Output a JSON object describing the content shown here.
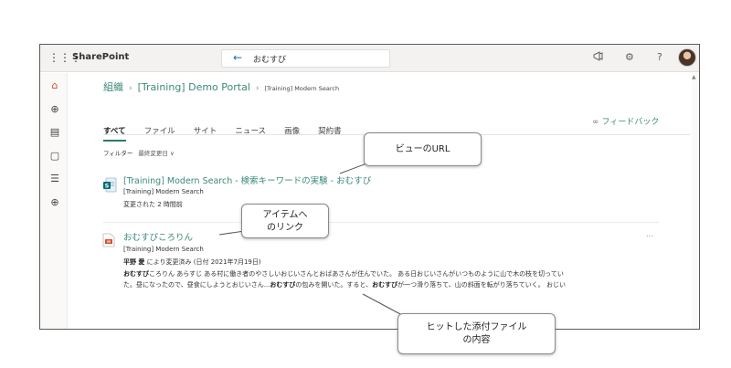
{
  "suitebar": {
    "app_name": "SharePoint",
    "back_arrow": "←",
    "search_query": "おむすび",
    "icons": [
      "megaphone-icon",
      "gear-icon",
      "help-icon"
    ],
    "help_glyph": "?"
  },
  "breadcrumb": {
    "item1": "組織",
    "item2": "[Training] Demo Portal",
    "item3": "[Training] Modern Search",
    "sep": "›"
  },
  "tabs": [
    "すべて",
    "ファイル",
    "サイト",
    "ニュース",
    "画像",
    "契約書"
  ],
  "feedback": {
    "label": "フィードバック"
  },
  "filter": {
    "label": "フィルター",
    "date_filter": "最終変更日 ∨"
  },
  "results": [
    {
      "title": "[Training] Modern Search - 検索キーワードの実験 - おむすび",
      "site": "[Training] Modern Search",
      "meta": "変更された 2 時間前",
      "icon": "sharepoint-page-icon"
    },
    {
      "title": "おむすびころりん",
      "site": "[Training] Modern Search",
      "author": "平野 愛",
      "meta_rest": " により変更済み (日付 2021年7月19日)",
      "snippet1_bold": "おむすび",
      "snippet1_rest": "ころりん あらすじ ある村に働き者のやさしいおじいさんとおばあさんが住んでいた。 ある日おじいさんがいつものように山で木の枝を切ってい",
      "snippet2_a": "た。昼になったので、昼食にしようとおじいさん...",
      "snippet2_b": "おむすび",
      "snippet2_c": "の包みを開いた。すると、",
      "snippet2_d": "おむすび",
      "snippet2_e": "が一つ滑り落ちて、山の斜面を転がり落ちていく。 おじい",
      "icon": "powerpoint-file-icon",
      "more": "..."
    }
  ],
  "callouts": {
    "view_url": "ビューのURL",
    "item_link_1": "アイテムへ",
    "item_link_2": "のリンク",
    "attachment_1": "ヒットした添付ファイル",
    "attachment_2": "の内容"
  },
  "colors": {
    "accent": "#3b8a7a",
    "suitebar": "#f3f2f1",
    "border": "#5a5a5a"
  }
}
